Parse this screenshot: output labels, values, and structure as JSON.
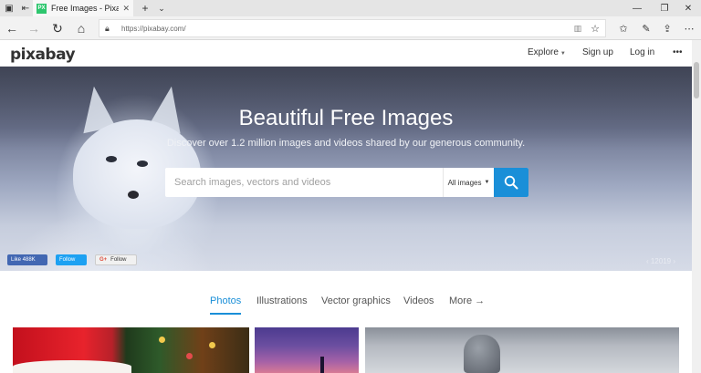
{
  "browser": {
    "tab_title": "Free Images - Pixabay",
    "tab_favicon": "PX",
    "url": "https://pixabay.com/",
    "icons": [
      "tab-list-icon",
      "tab-back-icon",
      "new-tab-icon",
      "tab-dropdown-icon",
      "minimize-icon",
      "maximize-icon",
      "close-window-icon",
      "back-icon",
      "forward-icon",
      "refresh-icon",
      "home-icon",
      "lock-icon",
      "reading-view-icon",
      "favorite-star-icon",
      "favorites-icon",
      "notes-icon",
      "share-icon",
      "more-icon"
    ]
  },
  "site": {
    "logo": "pixabay",
    "nav": {
      "explore": "Explore",
      "signup": "Sign up",
      "login": "Log in",
      "more": "•••"
    }
  },
  "hero": {
    "title": "Beautiful Free Images",
    "subtitle": "Discover over 1.2 million images and videos shared by our generous community.",
    "search_placeholder": "Search images, vectors and videos",
    "filter_label": "All images",
    "social": {
      "facebook": "Like 488K",
      "twitter": "Follow",
      "google": "Follow"
    },
    "credit": "‹  12019  ›"
  },
  "media_tabs": [
    {
      "label": "Photos",
      "active": true
    },
    {
      "label": "Illustrations",
      "active": false
    },
    {
      "label": "Vector graphics",
      "active": false
    },
    {
      "label": "Videos",
      "active": false
    },
    {
      "label": "More →",
      "active": false
    }
  ],
  "colors": {
    "accent": "#1a8fd8",
    "favicon": "#2ec66e",
    "facebook": "#4267b2",
    "twitter": "#1da1f2"
  }
}
